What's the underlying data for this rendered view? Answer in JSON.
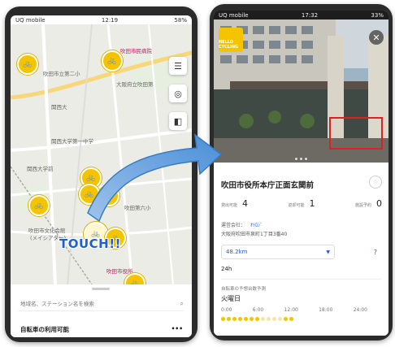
{
  "left_phone": {
    "status": {
      "carrier": "UQ mobile",
      "time": "12:19",
      "battery": "58%"
    },
    "map_labels": {
      "top_pink": "吹田市民病院",
      "top": "吹田市立第二小",
      "elementary": "大阪府立吹田第",
      "station_west": "関西大",
      "univ": "関西大学第一中学",
      "station_kandai": "関西大学前",
      "center": "吹田市文化会館",
      "center2": "(メイシアター)",
      "bottom_pink": "吹田市役所",
      "school": "吹田第六小"
    },
    "touch_label": "TOUCH!!",
    "search_placeholder": "地域名、ステーション名を検索",
    "availability_label": "自転車の利用可能",
    "more_label": "•••"
  },
  "right_phone": {
    "status": {
      "carrier": "UQ mobile",
      "time": "17:32",
      "battery": "33%"
    },
    "logo_text": "HELLO CYCLING",
    "station_name": "吹田市役所本庁正面玄関前",
    "stats": [
      {
        "label": "貸出可能",
        "value": "4"
      },
      {
        "label": "返却可能",
        "value": "1"
      },
      {
        "label": "施設予約",
        "value": "0"
      }
    ],
    "operator_label": "運営会社：",
    "operator_name": "ｵﾄﾛｼﾞ",
    "address": "大阪府吹田市泉町1丁目3番40",
    "distance": "48.2km",
    "help": "?",
    "hours": "24h",
    "forecast_title": "自転車の予想台数予測",
    "forecast_day": "火曜日",
    "times": [
      "0:00",
      "6:00",
      "12:00",
      "18:00",
      "24:00"
    ]
  },
  "colors": {
    "accent_yellow": "#f5c400",
    "link_blue": "#1e5fd8",
    "highlight_red": "#e02020"
  },
  "icons": [
    "bicycle-icon",
    "menu-icon",
    "locate-icon",
    "layers-icon",
    "close-icon",
    "search-icon",
    "favorite-icon",
    "caret-down-icon"
  ]
}
